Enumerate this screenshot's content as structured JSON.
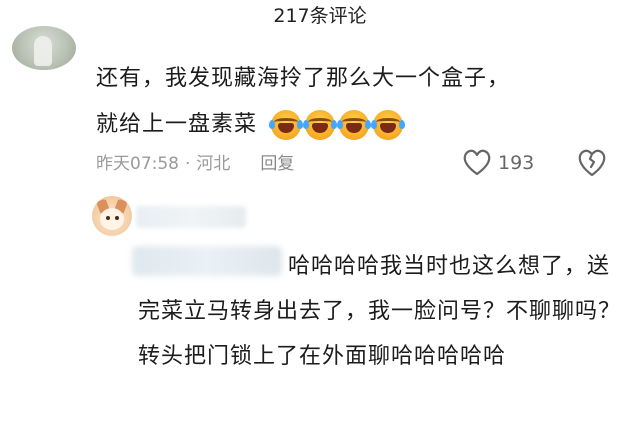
{
  "header": {
    "title": "217条评论"
  },
  "comment1": {
    "text_line1": "还有，我发现藏海拎了那么大一个盒子，",
    "text_line2": "就给上一盘素菜",
    "emoji_count": 4,
    "emoji_icon": "laughing-crying-face-icon",
    "time": "昨天07:58",
    "separator": "·",
    "location": "河北",
    "reply_label": "回复",
    "like_count": "193"
  },
  "comment2": {
    "text": "哈哈哈哈我当时也这么想了，送完菜立马转身出去了，我一脸问号？不聊聊吗？转头把门锁上了在外面聊哈哈哈哈哈"
  }
}
